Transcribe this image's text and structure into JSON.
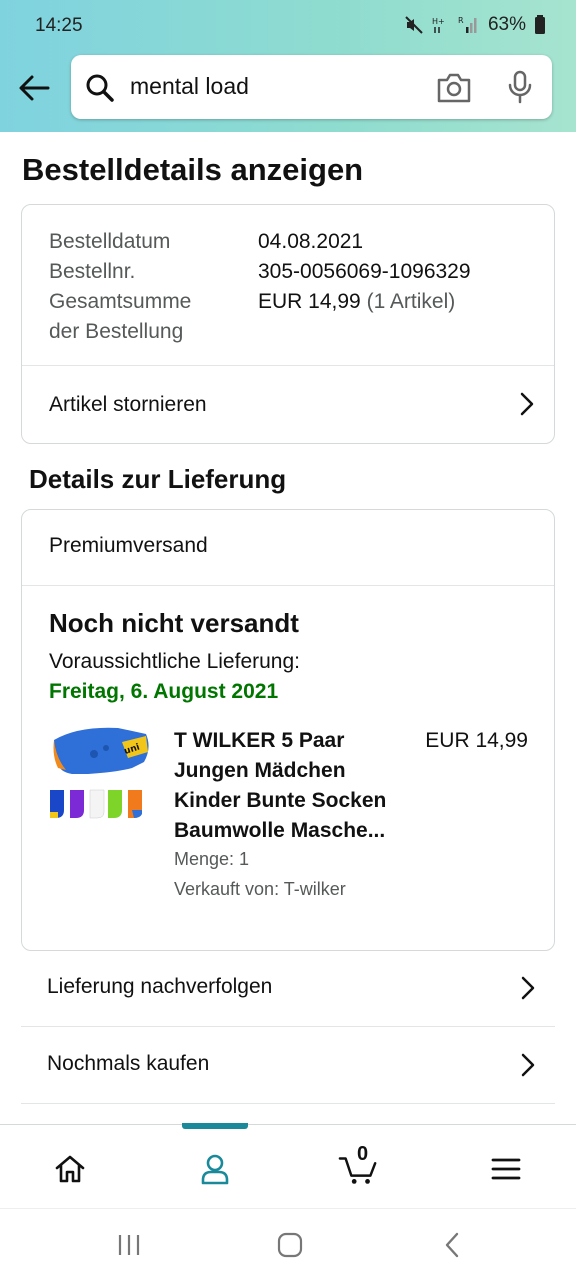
{
  "status_bar": {
    "time": "14:25",
    "battery": "63%"
  },
  "search": {
    "query": "mental load"
  },
  "page": {
    "title": "Bestelldetails anzeigen"
  },
  "order_summary": {
    "date_label": "Bestelldatum",
    "date_value": "04.08.2021",
    "number_label": "Bestellnr.",
    "number_value": "305-0056069-1096329",
    "total_label_line1": "Gesamtsumme",
    "total_label_line2": "der Bestellung",
    "total_value": "EUR 14,99",
    "total_count": "(1 Artikel)",
    "cancel_label": "Artikel stornieren"
  },
  "delivery": {
    "section_title": "Details zur Lieferung",
    "shipping_method": "Premiumversand",
    "status": "Noch nicht versandt",
    "eta_label": "Voraussichtliche Lieferung:",
    "eta_date": "Freitag, 6. August 2021",
    "product": {
      "title": "T WILKER 5 Paar Jungen Mädchen Kinder Bunte Socken Baumwolle Masche...",
      "price": "EUR 14,99",
      "quantity": "Menge: 1",
      "seller": "Verkauft von: T-wilker"
    }
  },
  "actions": {
    "track": "Lieferung nachverfolgen",
    "buy_again": "Nochmals kaufen"
  },
  "bottom_nav": {
    "cart_count": "0",
    "active": "account"
  },
  "colors": {
    "header_gradient_start": "#7fd3df",
    "header_gradient_end": "#a6e4cf",
    "eta_green": "#007600",
    "nav_accent": "#1a8a9a"
  }
}
